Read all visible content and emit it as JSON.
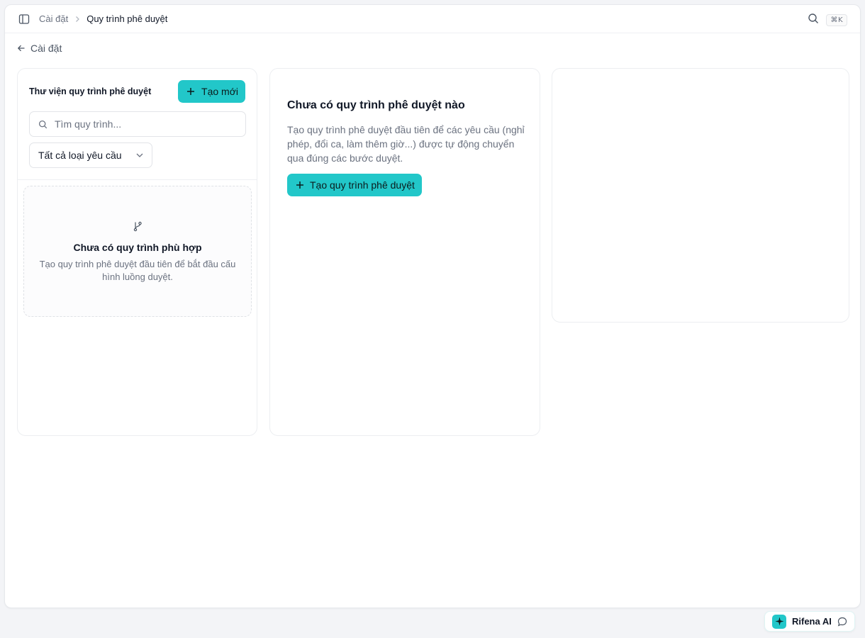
{
  "breadcrumb": {
    "parent": "Cài đặt",
    "current": "Quy trình phê duyệt"
  },
  "shortcut": "⌘K",
  "back_link": "Cài đặt",
  "library": {
    "title": "Thư viện quy trình phê duyệt",
    "new_button": "Tạo mới",
    "search_placeholder": "Tìm quy trình...",
    "filter_value": "Tất cả loại yêu cầu",
    "empty_title": "Chưa có quy trình phù hợp",
    "empty_desc": "Tạo quy trình phê duyệt đầu tiên để bắt đầu cấu hình luồng duyệt."
  },
  "main": {
    "title": "Chưa có quy trình phê duyệt nào",
    "desc": "Tạo quy trình phê duyệt đầu tiên để các yêu cầu (nghỉ phép, đổi ca, làm thêm giờ...) được tự động chuyển qua đúng các bước duyệt.",
    "create_button": "Tạo quy trình phê duyệt"
  },
  "ai": {
    "label": "Rifena AI"
  },
  "colors": {
    "accent": "#22c7c9",
    "background": "#f3f4f7",
    "muted_text": "#6b7280"
  },
  "icons": [
    "sidebar-toggle-icon",
    "chevron-right-icon",
    "search-icon",
    "arrow-left-icon",
    "plus-icon",
    "chevron-down-icon",
    "git-branch-icon",
    "sparkle-icon",
    "chat-bubble-icon"
  ]
}
